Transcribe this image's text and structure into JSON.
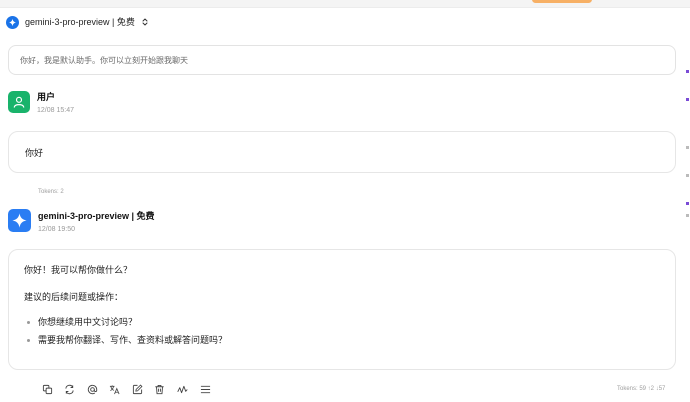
{
  "model_selector": {
    "label": "gemini-3-pro-preview | 免费"
  },
  "system_prompt": {
    "text": "你好，我是默认助手。你可以立刻开始跟我聊天"
  },
  "user_message": {
    "sender": "用户",
    "time": "12/08 15:47",
    "content": "你好",
    "tokens": "Tokens: 2"
  },
  "assistant_message": {
    "sender": "gemini-3-pro-preview | 免费",
    "time": "12/08 19:50",
    "greeting": "你好！我可以帮你做什么？",
    "suggest_heading": "建议的后续问题或操作：",
    "suggestions": [
      "你想继续用中文讨论吗？",
      "需要我帮你翻译、写作、查资料或解答问题吗？"
    ],
    "tokens": "Tokens: 59 ↑2 ↓57"
  },
  "action_icons": [
    "copy-icon",
    "regenerate-icon",
    "mention-icon",
    "translate-icon",
    "edit-icon",
    "delete-icon",
    "chart-icon",
    "menu-icon"
  ],
  "colors": {
    "user_avatar": "#19b36b",
    "assistant_avatar": "#2a7df3",
    "top_accent": "#f7b065"
  }
}
